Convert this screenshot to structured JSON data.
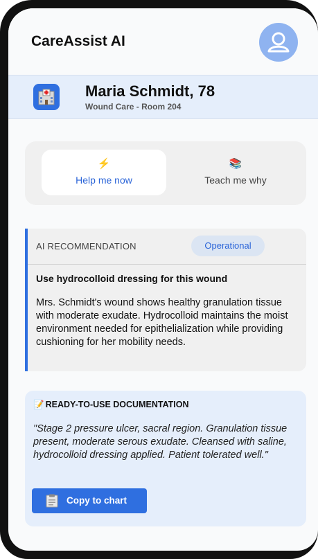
{
  "app": {
    "title": "CareAssist AI"
  },
  "patient": {
    "name": "Maria Schmidt, 78",
    "subtitle": "Wound Care - Room 204",
    "icon": "hospital-icon"
  },
  "modes": [
    {
      "icon": "⚡",
      "icon_name": "lightning-icon",
      "label": "Help me now",
      "active": true
    },
    {
      "icon": "📚",
      "icon_name": "books-icon",
      "label": "Teach me why",
      "active": false
    }
  ],
  "recommendation": {
    "label": "AI RECOMMENDATION",
    "badge": "Operational",
    "title": "Use hydrocolloid dressing for this wound",
    "body": "Mrs. Schmidt's wound shows healthy granulation tissue with moderate exudate. Hydrocolloid maintains the moist environment needed for epithelialization while providing cushioning for her mobility needs."
  },
  "documentation": {
    "icon": "📝",
    "heading": "READY-TO-USE DOCUMENTATION",
    "text": "\"Stage 2 pressure ulcer, sacral region. Granulation tissue present, moderate serous exudate. Cleansed with saline, hydrocolloid dressing applied. Patient tolerated well.\"",
    "button_label": "Copy to chart"
  },
  "colors": {
    "accent": "#2f6fe0",
    "patient_bar": "#e5eefb",
    "card_gray": "#f0f0f0",
    "badge_bg": "#dbe5f3"
  }
}
